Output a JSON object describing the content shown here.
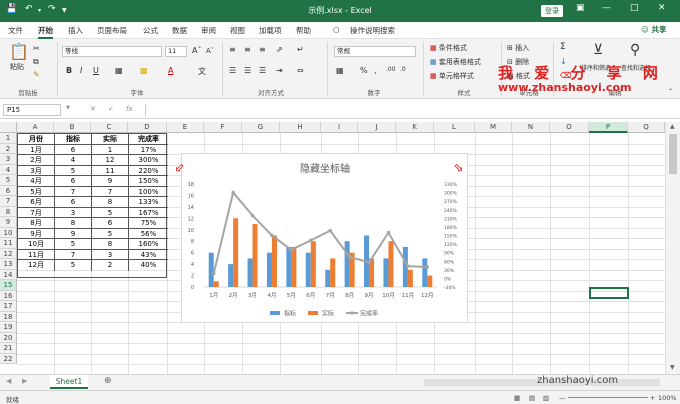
{
  "window": {
    "title": "示例.xlsx  -  Excel",
    "login": "登录",
    "share": "共享"
  },
  "menu": [
    "文件",
    "开始",
    "插入",
    "页面布局",
    "公式",
    "数据",
    "审阅",
    "视图",
    "加载项",
    "帮助",
    "操作说明搜索"
  ],
  "ribbon": {
    "paste": "粘贴",
    "font_name": "等线",
    "font_size": "11",
    "number_format": "常规",
    "conditional": "条件格式",
    "table_style": "套用表格格式",
    "cell_style": "单元格样式",
    "insert": "插入",
    "delete": "删除",
    "format": "格式",
    "sort_filter": "排序和筛选",
    "find_select": "查找和选择",
    "groups": {
      "clipboard": "剪贴板",
      "font": "字体",
      "align": "对齐方式",
      "number": "数字",
      "style": "样式",
      "cells": "单元格",
      "edit": "编辑"
    }
  },
  "watermark": {
    "top": "我 爱 分 享 网",
    "url": "www.zhanshaoyi.com",
    "bottom": "zhanshaoyi.com"
  },
  "formula_bar": {
    "namebox": "P15",
    "fx": "fx",
    "content": ""
  },
  "columns": [
    "A",
    "B",
    "C",
    "D",
    "E",
    "F",
    "G",
    "H",
    "I",
    "J",
    "K",
    "L",
    "M",
    "N",
    "O",
    "P",
    "Q"
  ],
  "selected_col": "P",
  "rows": [
    "1",
    "2",
    "3",
    "4",
    "5",
    "6",
    "7",
    "8",
    "9",
    "10",
    "11",
    "12",
    "13",
    "14",
    "15",
    "16",
    "17",
    "18",
    "19",
    "20",
    "21",
    "22"
  ],
  "selected_row": "15",
  "table": {
    "headers": [
      "月份",
      "指标",
      "实际",
      "完成率"
    ],
    "rows": [
      [
        "1月",
        "6",
        "1",
        "17%"
      ],
      [
        "2月",
        "4",
        "12",
        "300%"
      ],
      [
        "3月",
        "5",
        "11",
        "220%"
      ],
      [
        "4月",
        "6",
        "9",
        "150%"
      ],
      [
        "5月",
        "7",
        "7",
        "100%"
      ],
      [
        "6月",
        "6",
        "8",
        "133%"
      ],
      [
        "7月",
        "3",
        "5",
        "167%"
      ],
      [
        "8月",
        "8",
        "6",
        "75%"
      ],
      [
        "9月",
        "9",
        "5",
        "56%"
      ],
      [
        "10月",
        "5",
        "8",
        "160%"
      ],
      [
        "11月",
        "7",
        "3",
        "43%"
      ],
      [
        "12月",
        "5",
        "2",
        "40%"
      ]
    ]
  },
  "chart_data": {
    "type": "bar",
    "title": "隐藏坐标轴",
    "categories": [
      "1月",
      "2月",
      "3月",
      "4月",
      "5月",
      "6月",
      "7月",
      "8月",
      "9月",
      "10月",
      "11月",
      "12月"
    ],
    "series": [
      {
        "name": "指标",
        "type": "bar",
        "axis": "left",
        "color": "#5b9bd5",
        "values": [
          6,
          4,
          5,
          6,
          7,
          6,
          3,
          8,
          9,
          5,
          7,
          5
        ]
      },
      {
        "name": "实际",
        "type": "bar",
        "axis": "left",
        "color": "#ed7d31",
        "values": [
          1,
          12,
          11,
          9,
          7,
          8,
          5,
          6,
          5,
          8,
          3,
          2
        ]
      },
      {
        "name": "完成率",
        "type": "line",
        "axis": "right",
        "color": "#a5a5a5",
        "values": [
          17,
          300,
          220,
          150,
          100,
          133,
          167,
          75,
          56,
          160,
          43,
          40
        ]
      }
    ],
    "yleft": {
      "ylim": [
        0,
        18
      ],
      "ticks": [
        "0",
        "2",
        "4",
        "6",
        "8",
        "10",
        "12",
        "14",
        "16",
        "18"
      ]
    },
    "yright": {
      "ylim": [
        -30,
        330
      ],
      "ticks": [
        "-30%",
        "0%",
        "30%",
        "60%",
        "90%",
        "120%",
        "150%",
        "180%",
        "210%",
        "240%",
        "270%",
        "300%",
        "330%"
      ]
    },
    "legend": "bottom",
    "grid": false
  },
  "sheet_tab": "Sheet1",
  "status": {
    "ready": "就绪",
    "zoom": "100%"
  }
}
